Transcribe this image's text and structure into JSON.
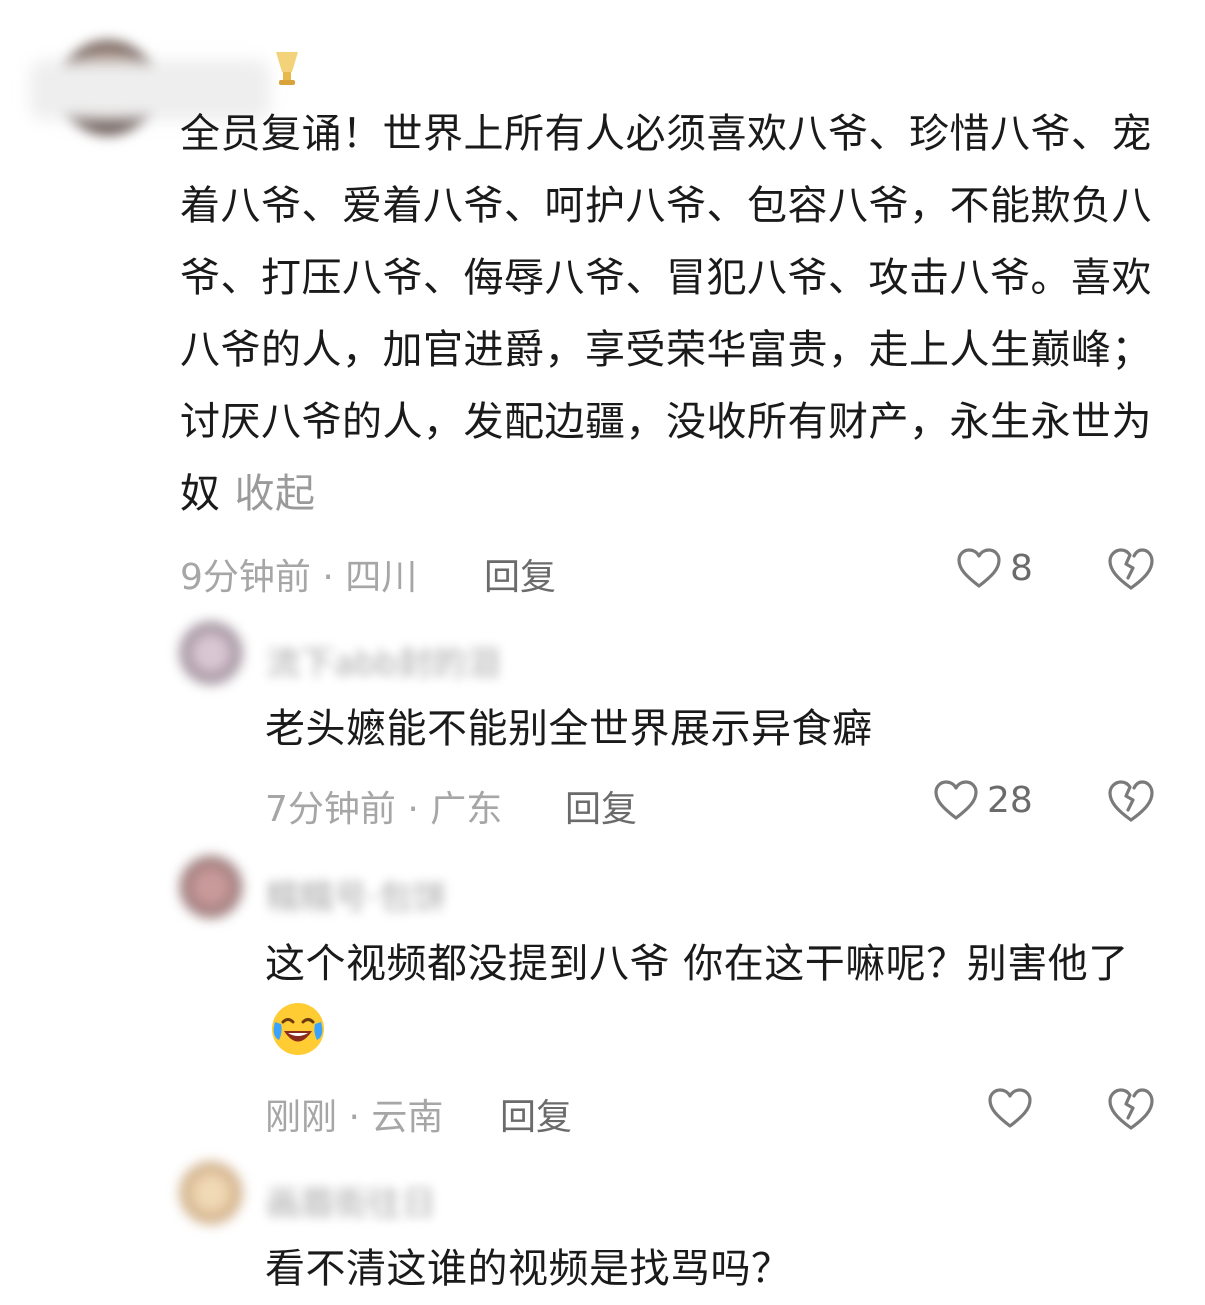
{
  "comments": [
    {
      "text": "全员复诵！世界上所有人必须喜欢八爷、珍惜八爷、宠着八爷、爱着八爷、呵护八爷、包容八爷，不能欺负八爷、打压八爷、侮辱八爷、冒犯八爷、攻击八爷。喜欢八爷的人，加官进爵，享受荣华富贵，走上人生巅峰；讨厌八爷的人，发配边疆，没收所有财产，永生永世为奴",
      "collapse_label": "收起",
      "time": "9分钟前",
      "location": "四川",
      "reply_label": "回复",
      "likes": "8"
    },
    {
      "username": "流下abb封的泪",
      "text": "老头嬷能不能别全世界展示异食癖",
      "time": "7分钟前",
      "location": "广东",
      "reply_label": "回复",
      "likes": "28"
    },
    {
      "username": "糯糯号·包饼",
      "text": "这个视频都没提到八爷 你在这干嘛呢？别害他了",
      "emoji": "crying-laughing-emoji",
      "time": "刚刚",
      "location": "云南",
      "reply_label": "回复",
      "likes": ""
    },
    {
      "username": "画眉街往日",
      "text": "看不清这谁的视频是找骂吗？"
    }
  ],
  "separator": " · ",
  "colors": {
    "text": "#1a1a1a",
    "meta": "#a6a6a6",
    "action": "#6b6b6b"
  }
}
